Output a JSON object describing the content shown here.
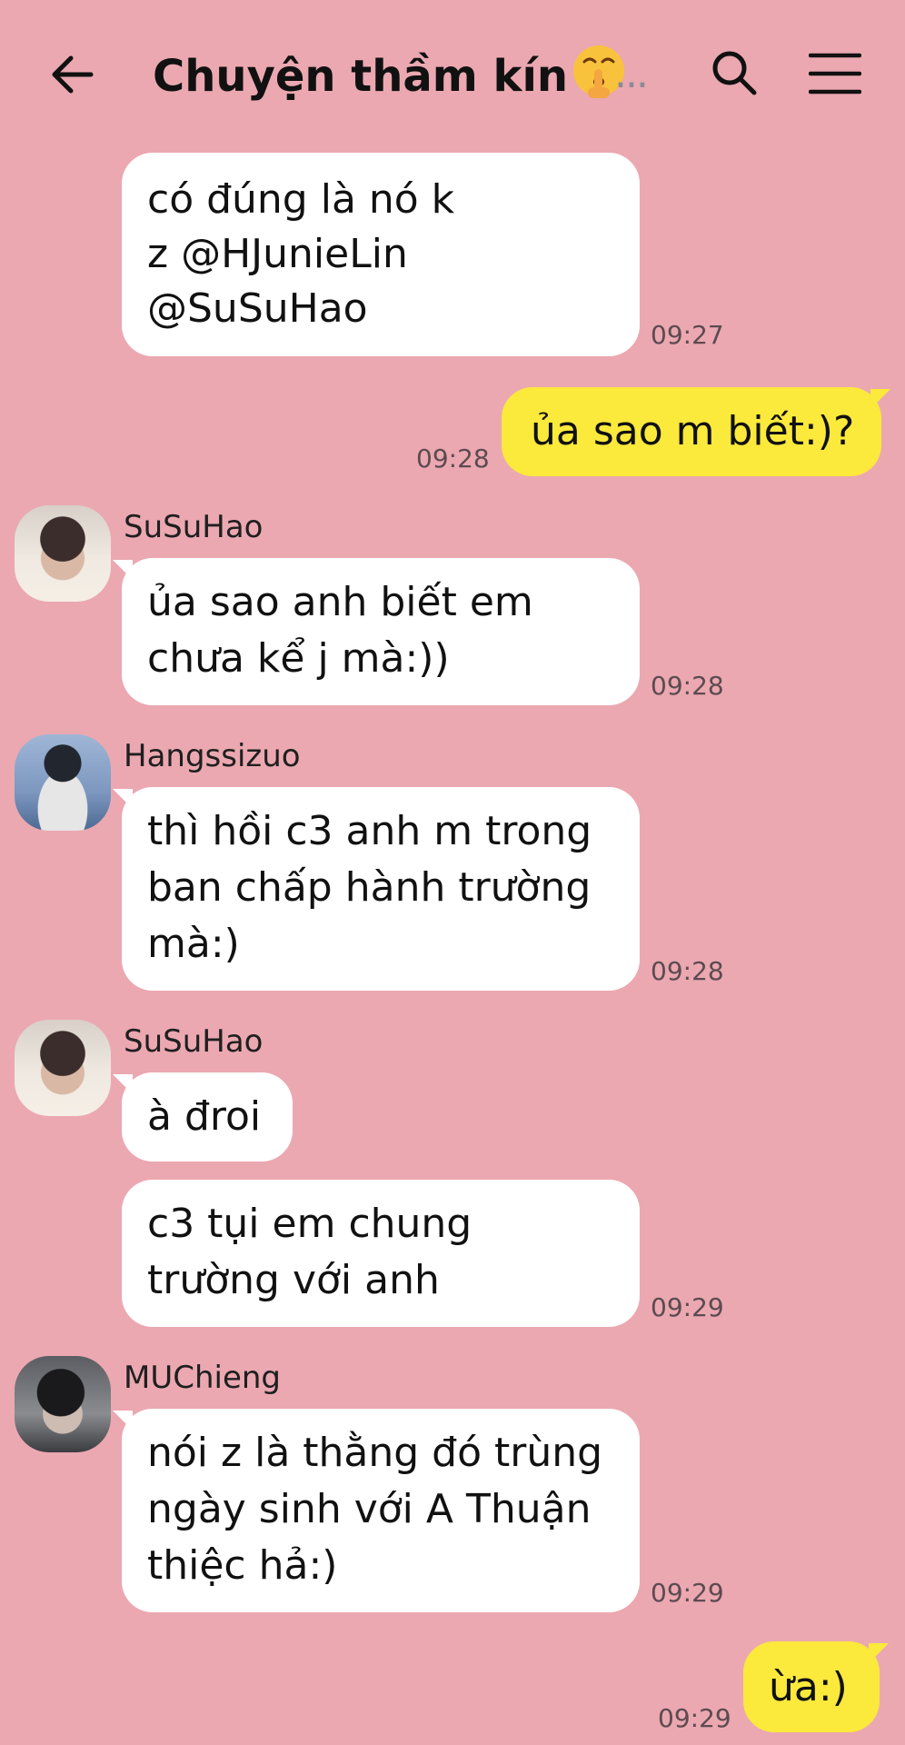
{
  "header": {
    "title": "Chuyện thầm kín",
    "more": "...",
    "back_icon": "arrow-left-icon",
    "search_icon": "search-icon",
    "menu_icon": "hamburger-menu-icon"
  },
  "messages": [
    {
      "sender": "",
      "mine": false,
      "lines": [
        "có đúng là nó k",
        "z @HJunieLin",
        "@SuSuHao"
      ],
      "time": "09:27"
    },
    {
      "sender": "",
      "mine": true,
      "lines": [
        "ủa sao m biết:)?"
      ],
      "time": "09:28"
    },
    {
      "sender": "SuSuHao",
      "mine": false,
      "lines": [
        "ủa sao anh biết em",
        "chưa kể j mà:))"
      ],
      "time": "09:28"
    },
    {
      "sender": "Hangssizuo",
      "mine": false,
      "lines": [
        "thì hồi c3 anh m trong",
        "ban chấp hành trường",
        "mà:)"
      ],
      "time": "09:28"
    },
    {
      "sender": "SuSuHao",
      "mine": false,
      "lines": [
        "à đroi"
      ],
      "time": ""
    },
    {
      "sender": "",
      "mine": false,
      "lines": [
        "c3 tụi em chung",
        "trường với anh"
      ],
      "time": "09:29"
    },
    {
      "sender": "MUChieng",
      "mine": false,
      "lines": [
        "nói z là thằng đó trùng",
        "ngày sinh với A Thuận",
        "thiệc hả:)"
      ],
      "time": "09:29"
    },
    {
      "sender": "",
      "mine": true,
      "lines": [
        "ừa:)"
      ],
      "time": "09:29"
    }
  ]
}
